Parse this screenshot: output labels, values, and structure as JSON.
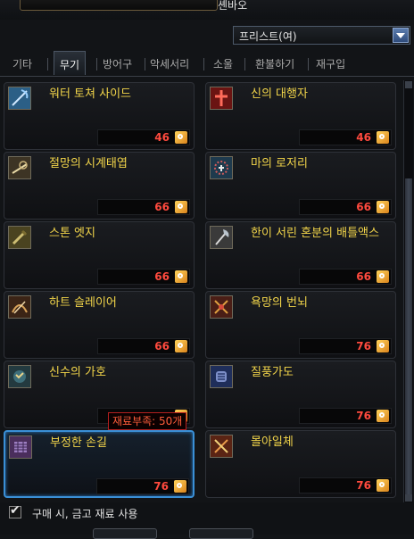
{
  "header": {
    "npc_name": "셴바오"
  },
  "class_select": {
    "value": "프리스트(여)"
  },
  "tabs": [
    {
      "label": "기타"
    },
    {
      "label": "무기"
    },
    {
      "label": "방어구"
    },
    {
      "label": "악세서리"
    },
    {
      "label": "소울"
    },
    {
      "label": "환불하기"
    },
    {
      "label": "재구입"
    }
  ],
  "active_tab": "무기",
  "items": [
    {
      "name": "워터 토쳐 사이드",
      "cost": "46",
      "icon": "scythe-icon"
    },
    {
      "name": "신의 대행자",
      "cost": "46",
      "icon": "red-cross-icon"
    },
    {
      "name": "절망의 시계태엽",
      "cost": "66",
      "icon": "clockwork-staff-icon"
    },
    {
      "name": "마의 로저리",
      "cost": "66",
      "icon": "rosary-icon"
    },
    {
      "name": "스톤 엣지",
      "cost": "66",
      "icon": "stone-blade-icon"
    },
    {
      "name": "한이 서린 혼분의 배틀액스",
      "cost": "66",
      "icon": "battle-axe-icon"
    },
    {
      "name": "하트 슬레이어",
      "cost": "66",
      "icon": "heart-slayer-icon"
    },
    {
      "name": "욕망의 번뇌",
      "cost": "76",
      "icon": "desire-totem-icon"
    },
    {
      "name": "신수의 가호",
      "cost": "",
      "icon": "guardian-beast-icon"
    },
    {
      "name": "질풍가도",
      "cost": "76",
      "icon": "gale-gauntlet-icon"
    },
    {
      "name": "부정한 손길",
      "cost": "76",
      "icon": "unholy-hand-icon"
    },
    {
      "name": "몰아일체",
      "cost": "76",
      "icon": "oneness-axe-icon"
    }
  ],
  "tooltip": {
    "text": "재료부족: 50개"
  },
  "option": {
    "label": "구매 시, 금고 재료 사용",
    "checked": true
  },
  "colors": {
    "item_name": "#f2d54a",
    "cost": "#ff4a3e",
    "selected_border": "#3a8fd6"
  }
}
